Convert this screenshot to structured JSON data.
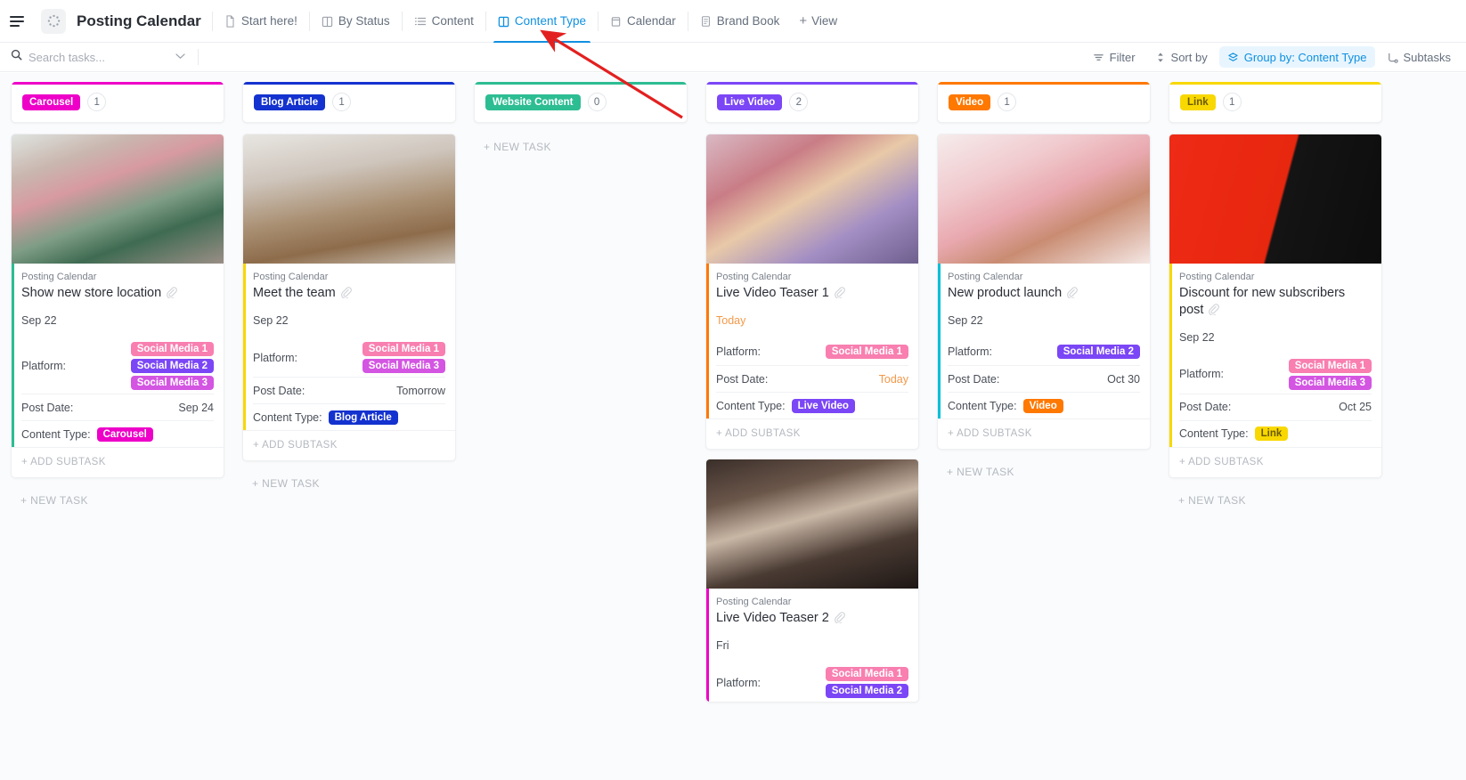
{
  "header": {
    "title": "Posting Calendar",
    "menu_icon": "hamburger-icon",
    "space_icon": "dotted-circle-icon",
    "tabs": [
      {
        "label": "Start here!",
        "icon": "doc-icon",
        "active": false
      },
      {
        "label": "By Status",
        "icon": "board-icon",
        "active": false
      },
      {
        "label": "Content",
        "icon": "list-icon",
        "active": false
      },
      {
        "label": "Content Type",
        "icon": "board-icon",
        "active": true
      },
      {
        "label": "Calendar",
        "icon": "calendar-icon",
        "active": false
      },
      {
        "label": "Brand Book",
        "icon": "doc-icon",
        "active": false
      }
    ],
    "add_view": {
      "label": "View",
      "plus": "+"
    }
  },
  "toolbar": {
    "search": {
      "placeholder": "Search tasks...",
      "value": "",
      "icon": "search-icon",
      "chevron": "chevron-down-icon"
    },
    "buttons": [
      {
        "label": "Filter",
        "icon": "filter-icon",
        "active": false
      },
      {
        "label": "Sort by",
        "icon": "sort-icon",
        "active": false
      },
      {
        "label": "Group by: Content Type",
        "icon": "group-icon",
        "active": true
      },
      {
        "label": "Subtasks",
        "icon": "subtask-icon",
        "active": false
      }
    ]
  },
  "labels": {
    "platform": "Platform:",
    "post_date": "Post Date:",
    "content_type": "Content Type:",
    "add_subtask": "+ ADD SUBTASK",
    "new_task": "+ NEW TASK",
    "list_name": "Posting Calendar",
    "attachment_icon": "paperclip-icon"
  },
  "colors": {
    "carousel": "#ee00c8",
    "blog_article": "#1432cf",
    "website_content": "#2dbd92",
    "live_video": "#7b46f6",
    "video": "#ff7800",
    "link": "#f8d800",
    "social_media_1": "#f87fb0",
    "social_media_2": "#7b46f6",
    "social_media_3": "#d355e2",
    "accent_blue": "#1090e0",
    "today_orange": "#f2994a",
    "arrow_red": "#e32020"
  },
  "columns": [
    {
      "status": "Carousel",
      "status_color": "#ee00c8",
      "count": "1",
      "cards": [
        {
          "list": "Posting Calendar",
          "name": "Show new store location",
          "due": "Sep 22",
          "due_today": false,
          "accent": "#2dbd92",
          "image": "storefront-photo",
          "platform": [
            {
              "label": "Social Media 1",
              "color": "#f87fb0"
            },
            {
              "label": "Social Media 2",
              "color": "#7b46f6"
            },
            {
              "label": "Social Media 3",
              "color": "#d355e2"
            }
          ],
          "post_date": "Sep 24",
          "post_date_today": false,
          "content_type": {
            "label": "Carousel",
            "color": "#ee00c8"
          }
        }
      ]
    },
    {
      "status": "Blog Article",
      "status_color": "#1432cf",
      "count": "1",
      "cards": [
        {
          "list": "Posting Calendar",
          "name": "Meet the team",
          "due": "Sep 22",
          "due_today": false,
          "accent": "#f8d800",
          "image": "team-meeting-photo",
          "platform": [
            {
              "label": "Social Media 1",
              "color": "#f87fb0"
            },
            {
              "label": "Social Media 3",
              "color": "#d355e2"
            }
          ],
          "post_date": "Tomorrow",
          "post_date_today": false,
          "content_type": {
            "label": "Blog Article",
            "color": "#1432cf"
          }
        }
      ]
    },
    {
      "status": "Website Content",
      "status_color": "#2dbd92",
      "count": "0",
      "cards": []
    },
    {
      "status": "Live Video",
      "status_color": "#7b46f6",
      "count": "2",
      "cards": [
        {
          "list": "Posting Calendar",
          "name": "Live Video Teaser 1",
          "due": "Today",
          "due_today": true,
          "accent": "#ff7800",
          "image": "makeup-session-photo",
          "platform": [
            {
              "label": "Social Media 1",
              "color": "#f87fb0"
            }
          ],
          "post_date": "Today",
          "post_date_today": true,
          "content_type": {
            "label": "Live Video",
            "color": "#7b46f6"
          }
        },
        {
          "list": "Posting Calendar",
          "name": "Live Video Teaser 2",
          "due": "Fri",
          "due_today": false,
          "accent": "#ee00c8",
          "image": "skincare-woman-photo",
          "platform": [
            {
              "label": "Social Media 1",
              "color": "#f87fb0"
            },
            {
              "label": "Social Media 2",
              "color": "#7b46f6"
            }
          ],
          "post_date": "",
          "post_date_today": false,
          "content_type": null
        }
      ]
    },
    {
      "status": "Video",
      "status_color": "#ff7800",
      "count": "1",
      "cards": [
        {
          "list": "Posting Calendar",
          "name": "New product launch",
          "due": "Sep 22",
          "due_today": false,
          "accent": "#00c0d8",
          "image": "rose-petals-serum-photo",
          "platform": [
            {
              "label": "Social Media 2",
              "color": "#7b46f6"
            }
          ],
          "post_date": "Oct 30",
          "post_date_today": false,
          "content_type": {
            "label": "Video",
            "color": "#ff7800"
          }
        }
      ]
    },
    {
      "status": "Link",
      "status_color": "#f8d800",
      "count": "1",
      "cards": [
        {
          "list": "Posting Calendar",
          "name": "Discount for new subscribers post",
          "due": "Sep 22",
          "due_today": false,
          "accent": "#f8d800",
          "image": "black-friday-sale-photo",
          "platform": [
            {
              "label": "Social Media 1",
              "color": "#f87fb0"
            },
            {
              "label": "Social Media 3",
              "color": "#d355e2"
            }
          ],
          "post_date": "Oct 25",
          "post_date_today": false,
          "content_type": {
            "label": "Link",
            "color": "#f8d800"
          }
        }
      ]
    }
  ]
}
